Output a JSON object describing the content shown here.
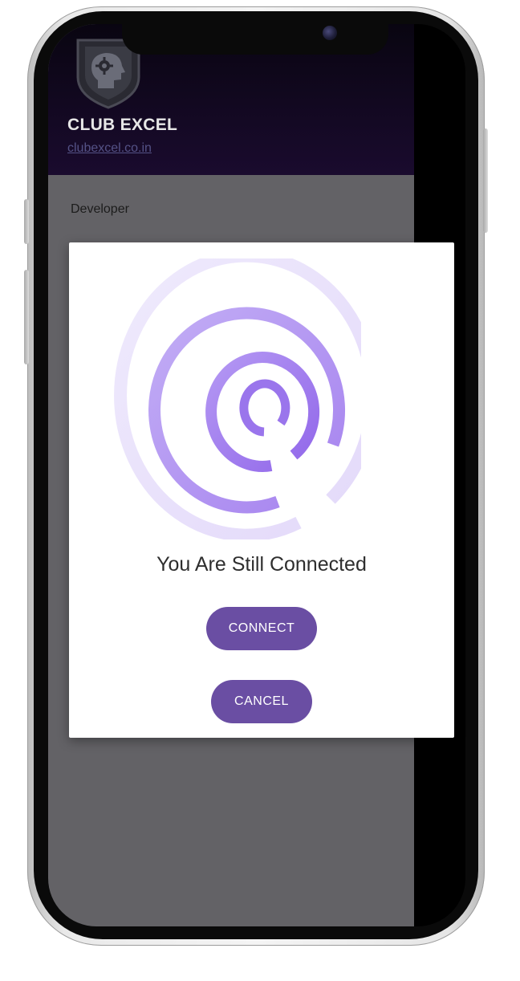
{
  "drawer": {
    "app_name": "CLUB EXCEL",
    "app_url": "clubexcel.co.in",
    "menu_items": [
      {
        "label": "Developer"
      }
    ]
  },
  "dialog": {
    "message": "You Are Still Connected",
    "connect_label": "CONNECT",
    "cancel_label": "CANCEL",
    "icon": "signal-rings-icon"
  },
  "colors": {
    "accent": "#6a4ea3",
    "ring_light": "#ede8fb",
    "ring_mid": "#b69cf2",
    "ring_dark": "#9a75ec",
    "drawer_bg": "#636266",
    "header_bg": "#14092a"
  }
}
